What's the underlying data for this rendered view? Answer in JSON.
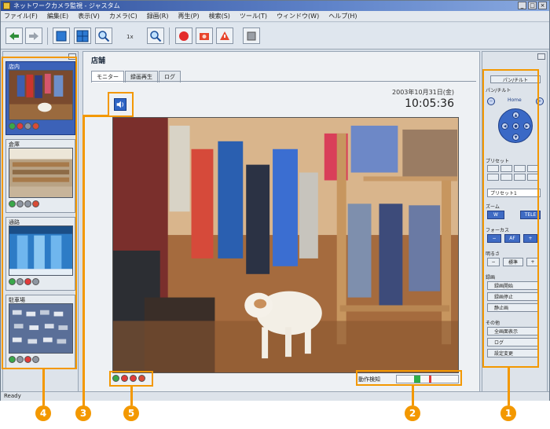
{
  "window": {
    "title": "ネットワークカメラ監視 - ジャスタム",
    "controls": [
      "_",
      "□",
      "×"
    ]
  },
  "menu": [
    "ファイル(F)",
    "編集(E)",
    "表示(V)",
    "カメラ(C)",
    "録画(R)",
    "再生(P)",
    "検索(S)",
    "ツール(T)",
    "ウィンドウ(W)",
    "ヘルプ(H)"
  ],
  "toolbar": {
    "zoom_label": "1x"
  },
  "left_panel": {
    "cameras": [
      {
        "label": "店内",
        "selected": true
      },
      {
        "label": "倉庫",
        "selected": false
      },
      {
        "label": "通路",
        "selected": false
      },
      {
        "label": "駐車場",
        "selected": false
      }
    ]
  },
  "viewer": {
    "title": "店舗",
    "tabs": [
      "モニター",
      "録画再生",
      "ログ"
    ],
    "date": "2003年10月31日(金)",
    "time": "10:05:36",
    "record_label": "動作検知",
    "record_segments": [
      {
        "start": 0.28,
        "end": 0.38,
        "color": "#2fae4a"
      },
      {
        "start": 0.52,
        "end": 0.56,
        "color": "#e43b3b"
      }
    ]
  },
  "right_panel": {
    "top_button": "パン/チルト",
    "pantilt_label": "パン/チルト",
    "home_label": "Home",
    "preset_label": "プリセット",
    "preset_select": "プリセット1",
    "zoom_label": "ズーム",
    "zoom_wide": "W",
    "zoom_tele": "TELE",
    "focus_label": "フォーカス",
    "focus_af": "AF",
    "iris_label": "明るさ",
    "iris_std": "標準",
    "record_label": "録画",
    "record_start": "録画開始",
    "record_stop": "録画停止",
    "record_snap": "静止画",
    "other_label": "その他",
    "other_1": "全画面表示",
    "other_2": "ログ",
    "other_3": "設定変更"
  },
  "statusbar": {
    "text": "Ready"
  },
  "callouts": [
    "4",
    "3",
    "5",
    "2",
    "1"
  ],
  "colors": {
    "highlight": "#f39800",
    "selected_card": "#3c62b8"
  }
}
